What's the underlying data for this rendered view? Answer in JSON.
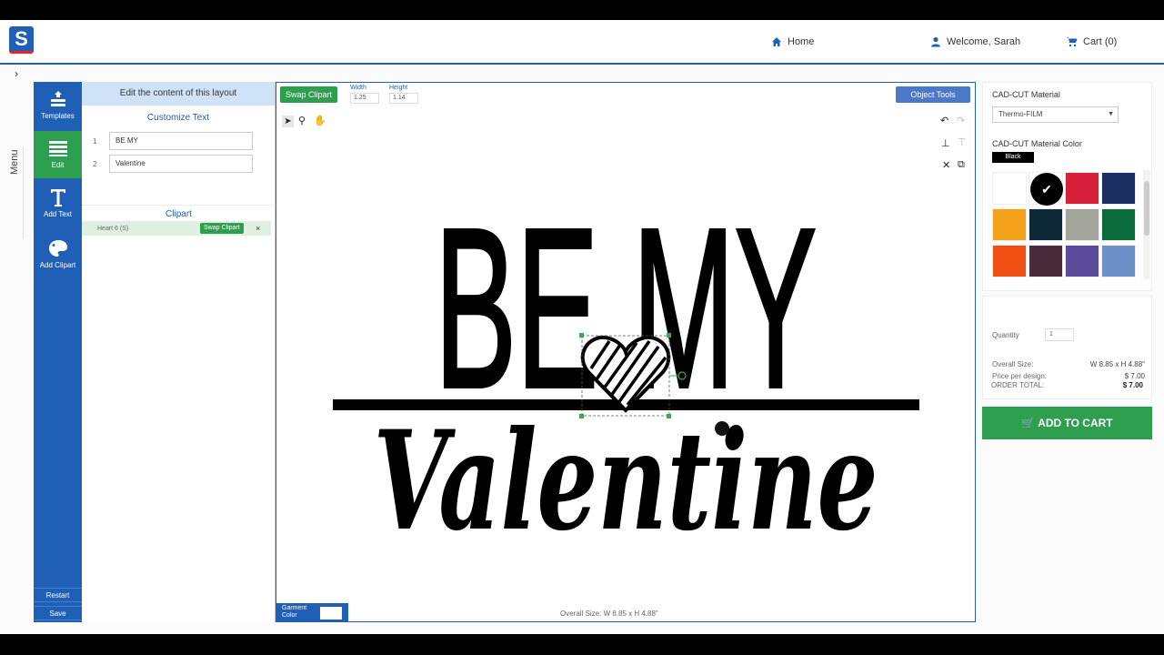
{
  "nav": {
    "logo": "S",
    "home": "Home",
    "welcome": "Welcome, Sarah",
    "cart": "Cart (0)",
    "menu": "Menu"
  },
  "sidebar": {
    "items": [
      {
        "label": "Templates"
      },
      {
        "label": "Edit"
      },
      {
        "label": "Add Text"
      },
      {
        "label": "Add Clipart"
      }
    ],
    "restart": "Restart",
    "save": "Save"
  },
  "panel": {
    "header": "Edit the content of this layout",
    "customize_title": "Customize Text",
    "texts": [
      {
        "num": "1",
        "value": "BE MY"
      },
      {
        "num": "2",
        "value": "Valentine"
      }
    ],
    "clipart_title": "Clipart",
    "clipart_item": "Heart 6 (S)",
    "clipart_swap": "Swap Clipart",
    "clipart_remove": "×"
  },
  "canvas": {
    "swap_clipart": "Swap Clipart",
    "width_label": "Width",
    "width_value": "1.25",
    "height_label": "Height",
    "height_value": "1.14",
    "object_tools": "Object Tools",
    "line1": "BE MY",
    "line2": "Valentine",
    "garment_color": "Garment Color",
    "overall_size": "Overall Size: W 8.85 x H 4.88\""
  },
  "right": {
    "material_label": "CAD-CUT Material",
    "material_value": "Thermo-FILM",
    "color_label": "CAD-CUT Material Color",
    "color_selected": "Black",
    "swatches": [
      "#ffffff",
      "#000000",
      "#d81f3a",
      "#1c2f63",
      "#f5a21b",
      "#0e2a3a",
      "#a3a49a",
      "#0b6b3a",
      "#f04e12",
      "#4a2a3a",
      "#5a4a9a",
      "#6b8fc7"
    ],
    "quantity_label": "Quantity",
    "quantity_value": "1",
    "overall_size_label": "Overall Size:",
    "overall_size_value": "W 8.85 x H 4.88\"",
    "price_label": "Price per design:",
    "price_value": "$ 7.00",
    "total_label": "ORDER TOTAL:",
    "total_value": "$ 7.00",
    "add_to_cart": "ADD TO CART"
  }
}
